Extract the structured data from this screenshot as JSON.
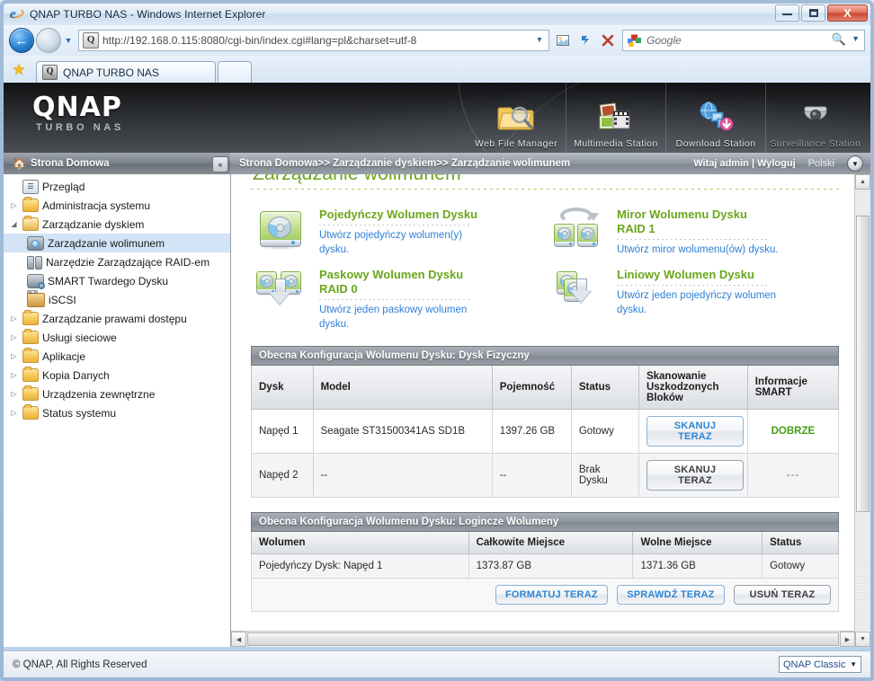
{
  "window": {
    "title": "QNAP TURBO NAS - Windows Internet Explorer",
    "minimize_label": "Minimize",
    "maximize_label": "Maximize",
    "close_label": "X"
  },
  "browser": {
    "back_label": "←",
    "forward_label": "→",
    "history_caret": "▼",
    "url_scheme": "http://",
    "url_host": "192.168.0.115",
    "url_rest": ":8080/cgi-bin/index.cgi#lang=pl&charset=utf-8",
    "url_full": "http://192.168.0.115:8080/cgi-bin/index.cgi#lang=pl&charset=utf-8",
    "favicon_letter": "Q",
    "url_dropdown": "▼",
    "feeds_icon": "feeds-icon",
    "refresh_icon": "refresh-icon",
    "stop_icon": "✕",
    "search_placeholder": "Google",
    "search_value": "",
    "search_icon": "⌕",
    "search_caret": "▼",
    "favorites_icon": "★",
    "tabs": [
      {
        "label": "QNAP TURBO NAS",
        "favicon": "Q",
        "active": true
      },
      {
        "label": "",
        "favicon": "",
        "active": false
      }
    ]
  },
  "qnap_header": {
    "logo": "QNAP",
    "tagline": "TURBO NAS",
    "shortcuts": [
      {
        "label": "Web File Manager",
        "icon": "folder-search-icon",
        "dim": false
      },
      {
        "label": "Multimedia Station",
        "icon": "photo-film-icon",
        "dim": false
      },
      {
        "label": "Download Station",
        "icon": "download-monitor-icon",
        "dim": false
      },
      {
        "label": "Surveillance Station",
        "icon": "camera-dome-icon",
        "dim": true
      }
    ]
  },
  "crumbbar": {
    "home_icon": "home-icon",
    "home_label": "Strona Domowa",
    "collapse_icon": "«",
    "path": "Strona Domowa>> Zarządzanie dyskiem>> Zarządzanie wolimunem",
    "welcome": "Witaj admin",
    "separator": "|",
    "logout": "Wyloguj",
    "language": "Polski",
    "language_caret": "▼"
  },
  "sidebar": {
    "items": [
      {
        "label": "Przegląd",
        "icon": "overview-icon",
        "level": 0,
        "twisty": "",
        "selected": false
      },
      {
        "label": "Administracja systemu",
        "icon": "folder-icon",
        "level": 0,
        "twisty": "▷",
        "selected": false
      },
      {
        "label": "Zarządzanie dyskiem",
        "icon": "folder-open-icon",
        "level": 0,
        "twisty": "◢",
        "selected": false
      },
      {
        "label": "Zarządzanie wolimunem",
        "icon": "volume-icon",
        "level": 1,
        "twisty": "",
        "selected": true
      },
      {
        "label": "Narzędzie Zarządzające RAID-em",
        "icon": "raid-icon",
        "level": 1,
        "twisty": "",
        "selected": false
      },
      {
        "label": "SMART Twardego Dysku",
        "icon": "smart-icon",
        "level": 1,
        "twisty": "",
        "selected": false
      },
      {
        "label": "iSCSI",
        "icon": "iscsi-icon",
        "level": 1,
        "twisty": "",
        "selected": false
      },
      {
        "label": "Zarządzanie prawami dostępu",
        "icon": "folder-icon",
        "level": 0,
        "twisty": "▷",
        "selected": false
      },
      {
        "label": "Usługi sieciowe",
        "icon": "folder-icon",
        "level": 0,
        "twisty": "▷",
        "selected": false
      },
      {
        "label": "Aplikacje",
        "icon": "folder-icon",
        "level": 0,
        "twisty": "▷",
        "selected": false
      },
      {
        "label": "Kopia Danych",
        "icon": "folder-icon",
        "level": 0,
        "twisty": "▷",
        "selected": false
      },
      {
        "label": "Urządzenia zewnętrzne",
        "icon": "folder-icon",
        "level": 0,
        "twisty": "▷",
        "selected": false
      },
      {
        "label": "Status systemu",
        "icon": "folder-icon",
        "level": 0,
        "twisty": "▷",
        "selected": false
      }
    ]
  },
  "page": {
    "title": "Zarządzanie wolimunem",
    "volume_options": [
      {
        "title": "Pojedyńczy Wolumen Dysku",
        "subtitle": "",
        "desc": "Utwórz pojedyńczy wolumen(y) dysku.",
        "icon": "single-disk-icon"
      },
      {
        "title": "Miror Wolumenu Dysku",
        "subtitle": "RAID 1",
        "desc": "Utwórz miror wolumenu(ów) dysku.",
        "icon": "mirror-disk-icon"
      },
      {
        "title": "Paskowy Wolumen Dysku",
        "subtitle": "RAID 0",
        "desc": "Utwórz jeden paskowy wolumen dysku.",
        "icon": "striped-disk-icon"
      },
      {
        "title": "Liniowy Wolumen Dysku",
        "subtitle": "",
        "desc": "Utwórz jeden pojedyńczy wolumen dysku.",
        "icon": "linear-disk-icon"
      }
    ],
    "physical": {
      "caption": "Obecna Konfiguracja Wolumenu Dysku: Dysk Fizyczny",
      "headers": [
        "Dysk",
        "Model",
        "Pojemność",
        "Status",
        "Skanowanie Uszkodzonych Bloków",
        "Informacje SMART"
      ],
      "rows": [
        {
          "disk": "Napęd 1",
          "model": "Seagate ST31500341AS SD1B",
          "capacity": "1397.26 GB",
          "status": "Gotowy",
          "scan_button": "SKANUJ TERAZ",
          "scan_enabled": true,
          "smart": "DOBRZE",
          "smart_ok": true
        },
        {
          "disk": "Napęd 2",
          "model": "--",
          "capacity": "--",
          "status": "Brak Dysku",
          "scan_button": "SKANUJ TERAZ",
          "scan_enabled": false,
          "smart": "---",
          "smart_ok": false
        }
      ]
    },
    "logical": {
      "caption": "Obecna Konfiguracja Wolumenu Dysku: Logincze Wolumeny",
      "headers": [
        "Wolumen",
        "Całkowite Miejsce",
        "Wolne Miejsce",
        "Status"
      ],
      "rows": [
        {
          "volume": "Pojedyńczy Dysk: Napęd 1",
          "total": "1373.87 GB",
          "free": "1371.36 GB",
          "status": "Gotowy"
        }
      ],
      "actions": [
        {
          "label": "FORMATUJ TERAZ",
          "primary": true
        },
        {
          "label": "SPRAWDŹ TERAZ",
          "primary": true
        },
        {
          "label": "USUŃ TERAZ",
          "primary": false
        }
      ]
    }
  },
  "scrollbars": {
    "up_arrow": "▲",
    "down_arrow": "▼",
    "left_arrow": "◀",
    "right_arrow": "▶"
  },
  "footer": {
    "copyright": "© QNAP, All Rights Reserved",
    "theme": "QNAP Classic",
    "theme_caret": "▼"
  },
  "colors": {
    "accent_green": "#6aa61c",
    "link_blue": "#2d7fd6",
    "status_ok": "#43a017",
    "header_gray": "#8f969f"
  }
}
